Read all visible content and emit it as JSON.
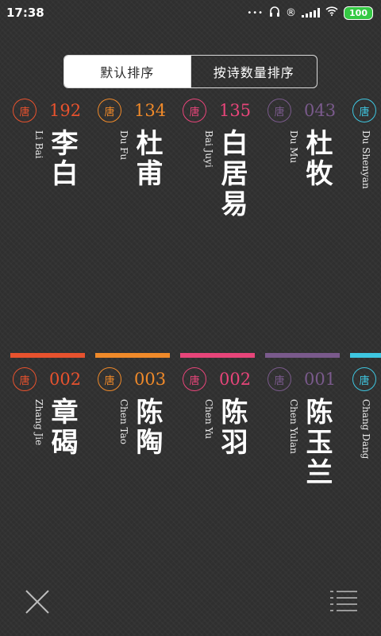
{
  "status_bar": {
    "time": "17:38",
    "dots": "•••",
    "headphone_icon": "headphones-icon",
    "r_icon": "®",
    "battery": "100"
  },
  "sort_tabs": {
    "default_label": "默认排序",
    "by_count_label": "按诗数量排序"
  },
  "poets_row1": [
    {
      "dynasty": "唐",
      "count": "192",
      "roman": "Li Bai",
      "name": "李白",
      "color": "#e8522e"
    },
    {
      "dynasty": "唐",
      "count": "134",
      "roman": "Du Fu",
      "name": "杜甫",
      "color": "#f08a2a"
    },
    {
      "dynasty": "唐",
      "count": "135",
      "roman": "Bai Juyi",
      "name": "白居易",
      "color": "#e8457a"
    },
    {
      "dynasty": "唐",
      "count": "043",
      "roman": "Du Mu",
      "name": "杜牧",
      "color": "#7a5a8c"
    },
    {
      "dynasty": "唐",
      "count": "",
      "roman": "Du Shenyan",
      "name": "",
      "color": "#3ec6e0"
    }
  ],
  "poets_row2": [
    {
      "dynasty": "唐",
      "count": "002",
      "roman": "Zhang Jie",
      "name": "章碣",
      "color": "#e8522e"
    },
    {
      "dynasty": "唐",
      "count": "003",
      "roman": "Chen Tao",
      "name": "陈陶",
      "color": "#f08a2a"
    },
    {
      "dynasty": "唐",
      "count": "002",
      "roman": "Chen Yu",
      "name": "陈羽",
      "color": "#e8457a"
    },
    {
      "dynasty": "唐",
      "count": "001",
      "roman": "Chen Yulan",
      "name": "陈玉兰",
      "color": "#7a5a8c"
    },
    {
      "dynasty": "唐",
      "count": "",
      "roman": "Chang Dang",
      "name": "",
      "color": "#3ec6e0"
    }
  ],
  "bottom": {
    "close_icon": "close-icon",
    "list_icon": "list-menu-icon"
  }
}
